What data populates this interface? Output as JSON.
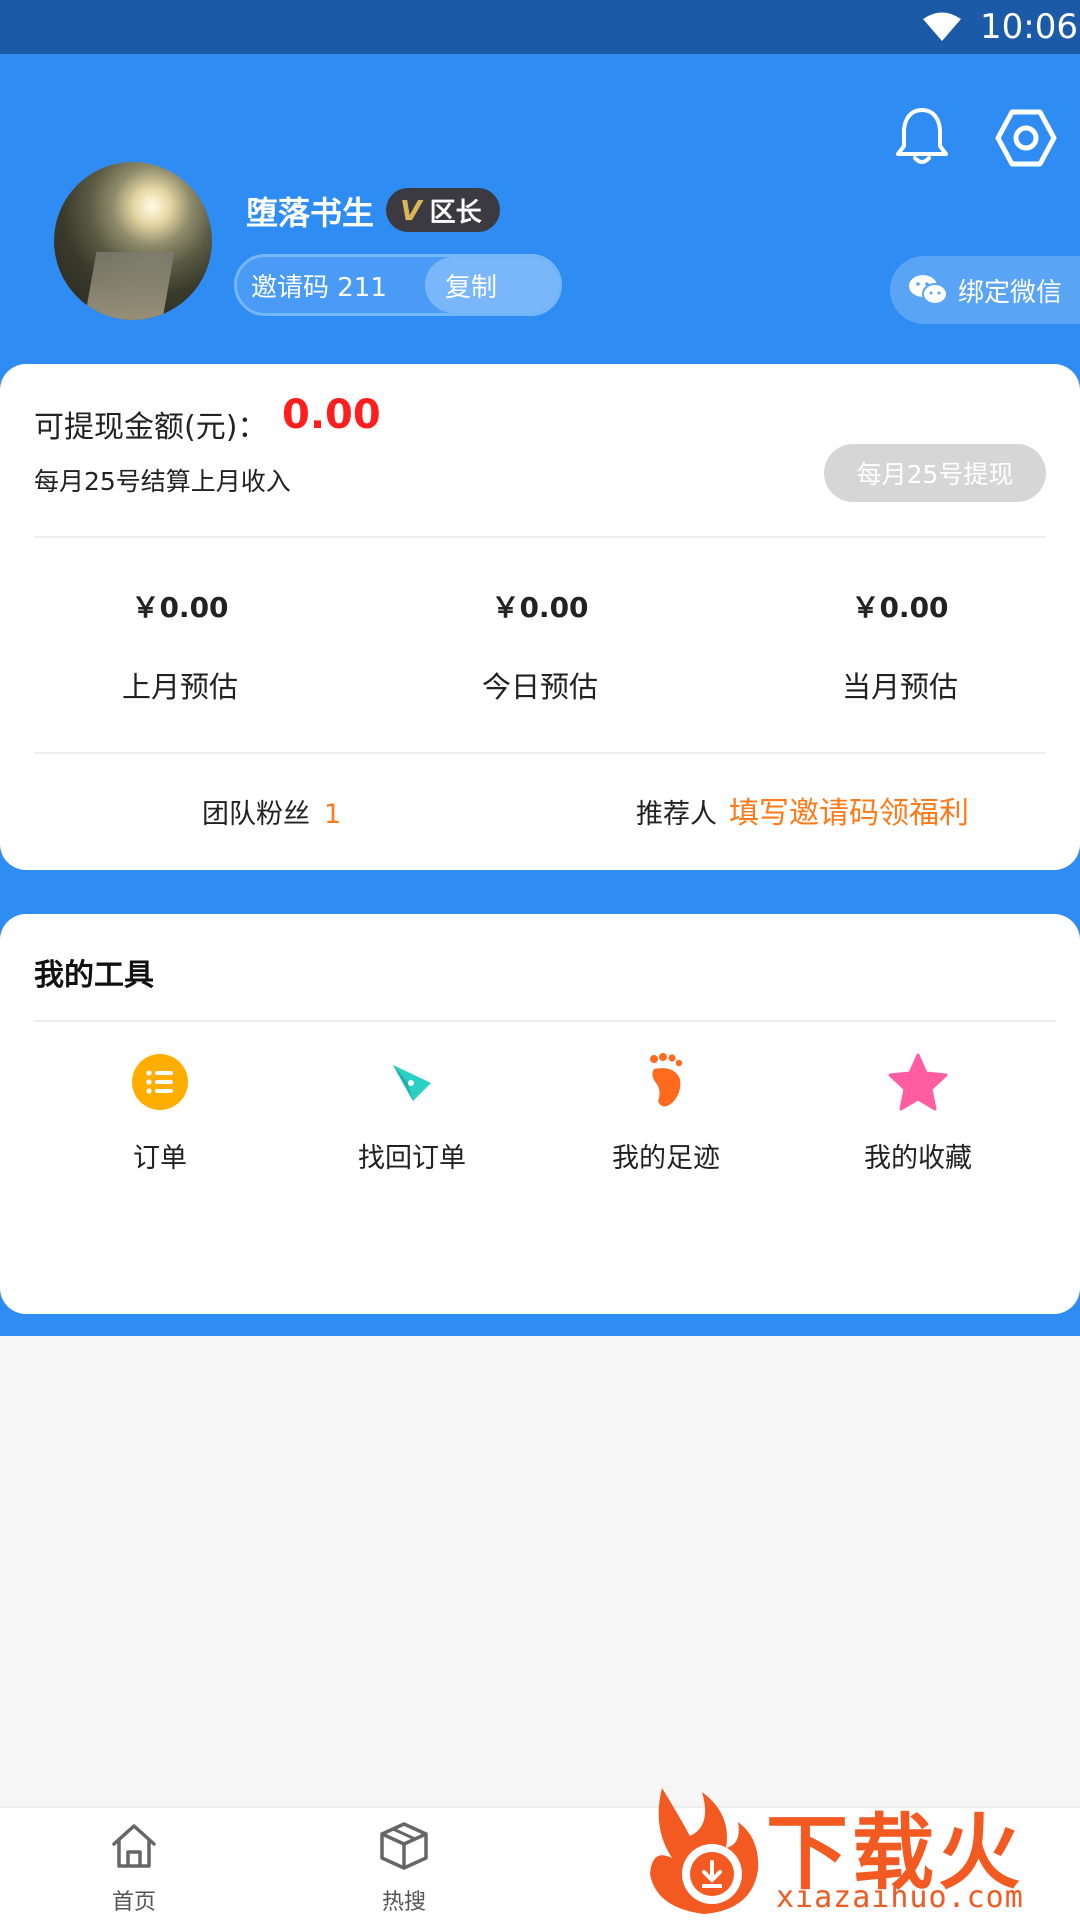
{
  "status_bar": {
    "time": "10:06"
  },
  "header": {
    "username": "堕落书生",
    "vip_badge": {
      "letter": "V",
      "rank": "区长"
    },
    "invite": {
      "code_label": "邀请码 211",
      "copy_label": "复制"
    },
    "bind_wechat_label": "绑定微信"
  },
  "earnings": {
    "withdrawable_label": "可提现金额(元)：",
    "withdrawable_amount": "0.00",
    "settlement_note": "每月25号结算上月收入",
    "withdraw_button": "每月25号提现",
    "stats": [
      {
        "value": "￥0.00",
        "label": "上月预估"
      },
      {
        "value": "￥0.00",
        "label": "今日预估"
      },
      {
        "value": "￥0.00",
        "label": "当月预估"
      }
    ],
    "team_label": "团队粉丝",
    "team_count": "1",
    "referrer_label": "推荐人",
    "referrer_link": "填写邀请码领福利"
  },
  "tools": {
    "title": "我的工具",
    "items": [
      {
        "label": "订单",
        "icon": "order-list-icon",
        "color": "#ffae00"
      },
      {
        "label": "找回订单",
        "icon": "retrieve-order-icon",
        "color": "#2bd0c4"
      },
      {
        "label": "我的足迹",
        "icon": "footprint-icon",
        "color": "#ff6a1f"
      },
      {
        "label": "我的收藏",
        "icon": "star-icon",
        "color": "#ff5ca2"
      }
    ]
  },
  "tabbar": {
    "tabs": [
      {
        "label": "首页",
        "icon": "home-icon"
      },
      {
        "label": "热搜",
        "icon": "box-icon"
      }
    ]
  },
  "watermark": {
    "text": "下载火",
    "url": "xiazaihuo.com"
  },
  "colors": {
    "primary": "#2f8cf2",
    "status_bar": "#1b5aa6",
    "accent_orange": "#ff7a1a",
    "amount_red": "#ff1d1d"
  }
}
